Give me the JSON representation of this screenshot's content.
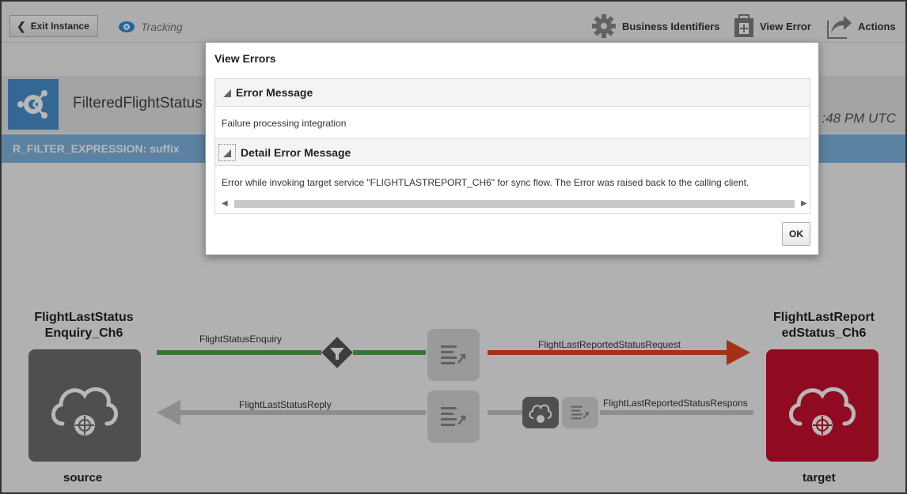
{
  "toolbar": {
    "exit_label": "Exit Instance",
    "tracking_label": "Tracking",
    "business_identifiers_label": "Business Identifiers",
    "view_error_label": "View Error",
    "actions_label": "Actions"
  },
  "header": {
    "integration_name": "FilteredFlightStatus",
    "timestamp_fragment": ":48 PM UTC",
    "error_fragment": "R_FILTER_EXPRESSION: suffix"
  },
  "flow": {
    "source": {
      "name": "FlightLastStatus Enquiry_Ch6",
      "role": "source",
      "color": "#6e6e6e"
    },
    "target": {
      "name": "FlightLastReport edStatus_Ch6",
      "role": "target",
      "color": "#c8102e"
    },
    "request_label": "FlightStatusEnquiry",
    "target_request_label": "FlightLastReportedStatusRequest",
    "reply_label": "FlightLastStatusReply",
    "target_response_label": "FlightLastReportedStatusRespons",
    "colors": {
      "success_line": "#4ba34b",
      "error_line": "#e3441c",
      "idle_line": "#c4c4c4"
    }
  },
  "dialog": {
    "title": "View Errors",
    "error_message_heading": "Error Message",
    "error_message_text": "Failure processing integration",
    "detail_heading": "Detail Error Message",
    "detail_text": "Error while invoking target service \"FLIGHTLASTREPORT_CH6\" for sync flow. The Error was raised back to the calling client.",
    "ok_label": "OK"
  }
}
